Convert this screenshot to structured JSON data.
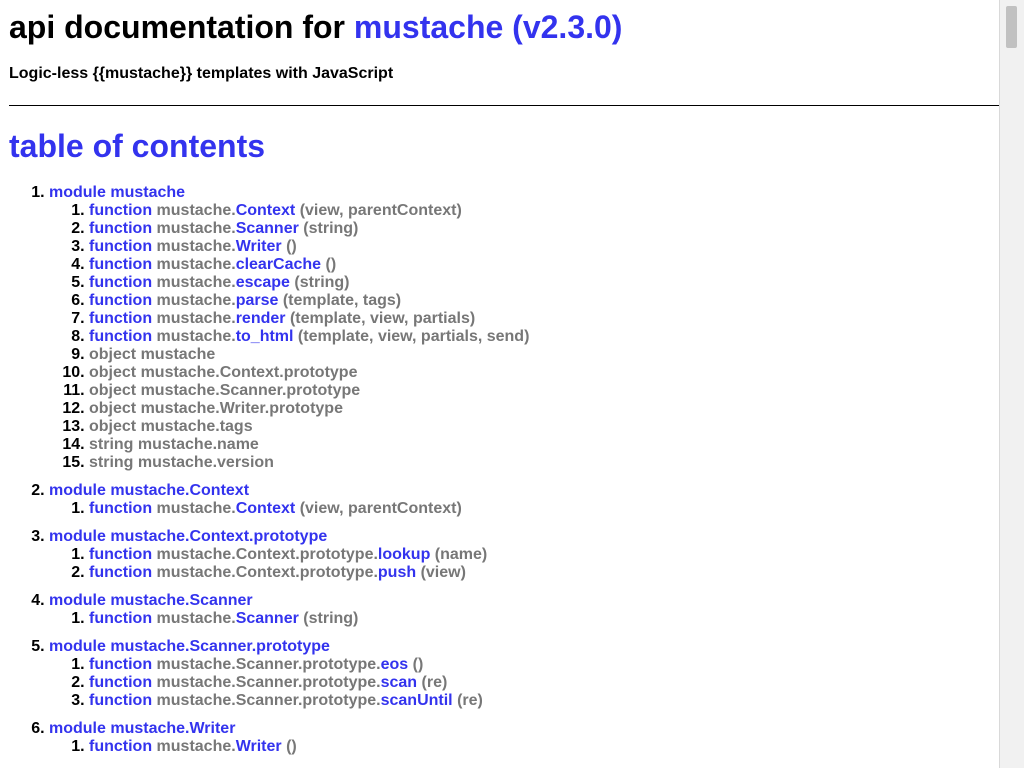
{
  "header": {
    "title_prefix": "api documentation for ",
    "project": "mustache (v2.3.0)",
    "description": "Logic-less {{mustache}} templates with JavaScript"
  },
  "toc": {
    "heading": "table of contents",
    "modules": [
      {
        "label": "module mustache",
        "items": [
          {
            "kind": "function",
            "prefix": "mustache.",
            "name": "Context",
            "args": "(view, parentContext)"
          },
          {
            "kind": "function",
            "prefix": "mustache.",
            "name": "Scanner",
            "args": "(string)"
          },
          {
            "kind": "function",
            "prefix": "mustache.",
            "name": "Writer",
            "args": "()"
          },
          {
            "kind": "function",
            "prefix": "mustache.",
            "name": "clearCache",
            "args": "()"
          },
          {
            "kind": "function",
            "prefix": "mustache.",
            "name": "escape",
            "args": "(string)"
          },
          {
            "kind": "function",
            "prefix": "mustache.",
            "name": "parse",
            "args": "(template, tags)"
          },
          {
            "kind": "function",
            "prefix": "mustache.",
            "name": "render",
            "args": "(template, view, partials)"
          },
          {
            "kind": "function",
            "prefix": "mustache.",
            "name": "to_html",
            "args": "(template, view, partials, send)"
          },
          {
            "kind": "text",
            "text": "object mustache"
          },
          {
            "kind": "text",
            "text": "object mustache.Context.prototype"
          },
          {
            "kind": "text",
            "text": "object mustache.Scanner.prototype"
          },
          {
            "kind": "text",
            "text": "object mustache.Writer.prototype"
          },
          {
            "kind": "text",
            "text": "object mustache.tags"
          },
          {
            "kind": "text",
            "text": "string mustache.name"
          },
          {
            "kind": "text",
            "text": "string mustache.version"
          }
        ]
      },
      {
        "label": "module mustache.Context",
        "items": [
          {
            "kind": "function",
            "prefix": "mustache.",
            "name": "Context",
            "args": "(view, parentContext)"
          }
        ]
      },
      {
        "label": "module mustache.Context.prototype",
        "items": [
          {
            "kind": "function",
            "prefix": "mustache.Context.prototype.",
            "name": "lookup",
            "args": "(name)"
          },
          {
            "kind": "function",
            "prefix": "mustache.Context.prototype.",
            "name": "push",
            "args": "(view)"
          }
        ]
      },
      {
        "label": "module mustache.Scanner",
        "items": [
          {
            "kind": "function",
            "prefix": "mustache.",
            "name": "Scanner",
            "args": "(string)"
          }
        ]
      },
      {
        "label": "module mustache.Scanner.prototype",
        "items": [
          {
            "kind": "function",
            "prefix": "mustache.Scanner.prototype.",
            "name": "eos",
            "args": "()"
          },
          {
            "kind": "function",
            "prefix": "mustache.Scanner.prototype.",
            "name": "scan",
            "args": "(re)"
          },
          {
            "kind": "function",
            "prefix": "mustache.Scanner.prototype.",
            "name": "scanUntil",
            "args": "(re)"
          }
        ]
      },
      {
        "label": "module mustache.Writer",
        "items": [
          {
            "kind": "function",
            "prefix": "mustache.",
            "name": "Writer",
            "args": "()"
          }
        ]
      }
    ]
  }
}
